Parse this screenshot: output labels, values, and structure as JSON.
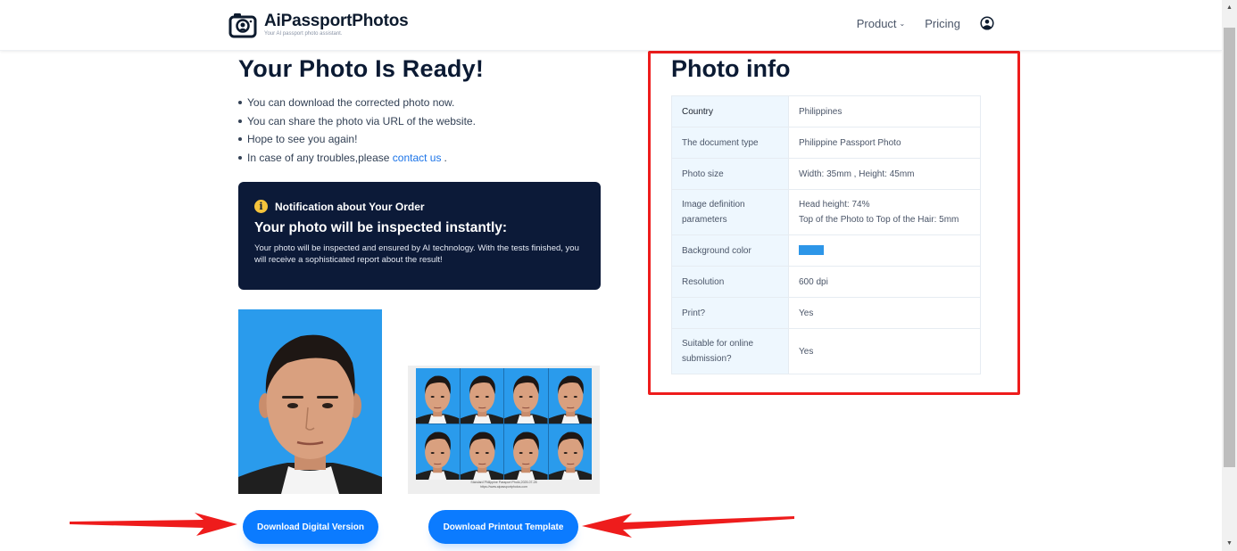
{
  "header": {
    "brand_name": "AiPassportPhotos",
    "brand_tagline": "Your AI passport photo assistant.",
    "nav": {
      "product_label": "Product",
      "pricing_label": "Pricing"
    },
    "icons": {
      "logo": "camera-icon",
      "dropdown": "chevron-down-icon",
      "account": "user-circle-icon"
    }
  },
  "main": {
    "title": "Your Photo Is Ready!",
    "bullets": [
      "You can download the corrected photo now.",
      "You can share the photo via URL of the website.",
      "Hope to see you again!"
    ],
    "trouble_prefix": "In case of any troubles,please ",
    "contact_link": "contact us",
    "trouble_suffix": ".",
    "notice": {
      "heading": "Notification about Your Order",
      "subheading": "Your photo will be inspected instantly:",
      "body": "Your photo will be inspected and ensured by AI technology. With the tests finished, you will receive a sophisticated report about the result!",
      "icon": "info-icon"
    },
    "print_caption_line1": "Standard Philippine Passport Photo,2025-07-28",
    "print_caption_line2": "https://www.aipassportphotos.com",
    "buttons": {
      "download_digital": "Download Digital Version",
      "download_print": "Download Printout Template"
    }
  },
  "photo_info": {
    "title": "Photo info",
    "rows": [
      {
        "key": "Country",
        "value": "Philippines"
      },
      {
        "key": "The document type",
        "value": "Philippine Passport Photo"
      },
      {
        "key": "Photo size",
        "value": "Width: 35mm , Height: 45mm"
      },
      {
        "key": "Image definition parameters",
        "value": "Head height: 74%",
        "value2": "Top of the Photo to Top of the Hair: 5mm"
      },
      {
        "key": "Background color",
        "value": ""
      },
      {
        "key": "Resolution",
        "value": "600 dpi"
      },
      {
        "key": "Print?",
        "value": "Yes"
      },
      {
        "key": "Suitable for online submission?",
        "value": "Yes"
      }
    ],
    "background_color_hex": "#2d96e8"
  },
  "colors": {
    "accent": "#0b7bff",
    "notice_bg": "#0c1a38",
    "highlight_border": "#ee1c1c",
    "photo_bg": "#2a9bec"
  }
}
